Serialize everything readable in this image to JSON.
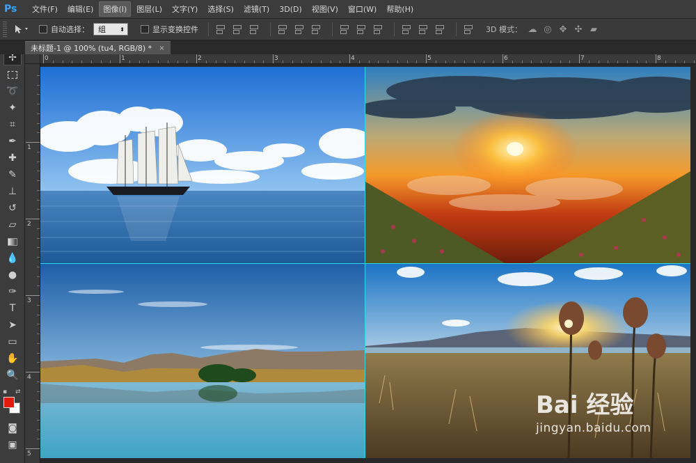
{
  "app": {
    "logo": "Ps",
    "accent": "#31a8ff"
  },
  "menu": [
    "文件(F)",
    "编辑(E)",
    "图像(I)",
    "图层(L)",
    "文字(Y)",
    "选择(S)",
    "滤镜(T)",
    "3D(D)",
    "视图(V)",
    "窗口(W)",
    "帮助(H)"
  ],
  "menu_active_index": 2,
  "options": {
    "auto_select_label": "自动选择：",
    "auto_select_value": "组",
    "show_transform_label": "显示变换控件",
    "mode_3d_label": "3D 模式："
  },
  "document": {
    "tab_title": "未标题-1 @ 100% (tu4, RGB/8) *",
    "close_glyph": "×"
  },
  "rulers": {
    "top": [
      "0",
      "1",
      "2",
      "3",
      "4",
      "5",
      "6",
      "7",
      "8"
    ],
    "left": [
      "1",
      "2",
      "3",
      "4",
      "5"
    ]
  },
  "colors": {
    "foreground": "#e21a0e",
    "background": "#ffffff",
    "guide": "#2fd9e8"
  },
  "images": [
    {
      "name": "sailing-ship-sea"
    },
    {
      "name": "sunset-mountain-valley"
    },
    {
      "name": "mountain-lake-reflection"
    },
    {
      "name": "sunrise-desert-plants"
    }
  ],
  "watermark": {
    "logo": "Bai  经验",
    "url": "jingyan.baidu.com"
  }
}
